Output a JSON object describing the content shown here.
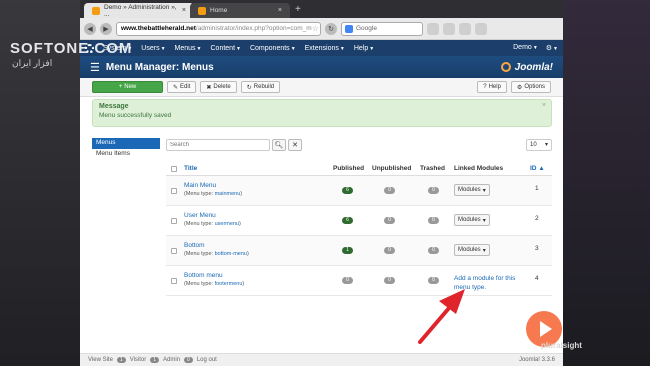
{
  "browser": {
    "tabs": [
      {
        "label": "Demo » Administration », ..."
      },
      {
        "label": "Home"
      }
    ],
    "url_host": "www.thebattleherald.net",
    "url_path": "/administrator/index.php?option=com_m",
    "search_placeholder": "Google"
  },
  "admin_nav": {
    "items": [
      {
        "label": "System"
      },
      {
        "label": "Users"
      },
      {
        "label": "Menus"
      },
      {
        "label": "Content"
      },
      {
        "label": "Components"
      },
      {
        "label": "Extensions"
      },
      {
        "label": "Help"
      }
    ],
    "site_label": "Demo",
    "settings_label": "⚙"
  },
  "header": {
    "title": "Menu Manager: Menus",
    "brand": "Joomla!"
  },
  "toolbar": {
    "new_label": "New",
    "edit_label": "Edit",
    "delete_label": "Delete",
    "rebuild_label": "Rebuild",
    "help_label": "Help",
    "options_label": "Options"
  },
  "message": {
    "title": "Message",
    "text": "Menu successfully saved",
    "close": "×"
  },
  "sidebar": {
    "items": [
      {
        "label": "Menus",
        "active": true
      },
      {
        "label": "Menu Items",
        "active": false
      }
    ]
  },
  "filter": {
    "search_placeholder": "Search",
    "limit": "10"
  },
  "table": {
    "headers": {
      "title": "Title",
      "published": "Published",
      "unpublished": "Unpublished",
      "trashed": "Trashed",
      "linked_modules": "Linked Modules",
      "id": "ID ▲"
    },
    "menu_type_prefix": "(Menu type: ",
    "menu_type_suffix": ")",
    "modules_button": "Modules",
    "rows": [
      {
        "title": "Main Menu",
        "type": "mainmenu",
        "published": "6",
        "unpublished": "0",
        "trashed": "0",
        "modules": "button",
        "id": "1"
      },
      {
        "title": "User Menu",
        "type": "usermenu",
        "published": "6",
        "unpublished": "0",
        "trashed": "0",
        "modules": "button",
        "id": "2"
      },
      {
        "title": "Bottom",
        "type": "bottom-menu",
        "published": "1",
        "unpublished": "0",
        "trashed": "0",
        "modules": "button",
        "id": "3"
      },
      {
        "title": "Bottom menu",
        "type": "footermenu",
        "published": "0",
        "unpublished": "0",
        "trashed": "0",
        "modules": "Add a module for this menu type.",
        "id": "4"
      }
    ]
  },
  "statusbar": {
    "view_site": "View Site",
    "visitors_count": "1",
    "visitors_label": "Visitor",
    "admin_count": "1",
    "admin_label": "Admin",
    "messages_count": "0",
    "logout": "Log out",
    "version": "Joomla! 3.3.6"
  },
  "overlays": {
    "watermark": "SOFTONE.COM",
    "watermark_sub": "افزار ایران",
    "pluralsight": "pluralsight"
  }
}
